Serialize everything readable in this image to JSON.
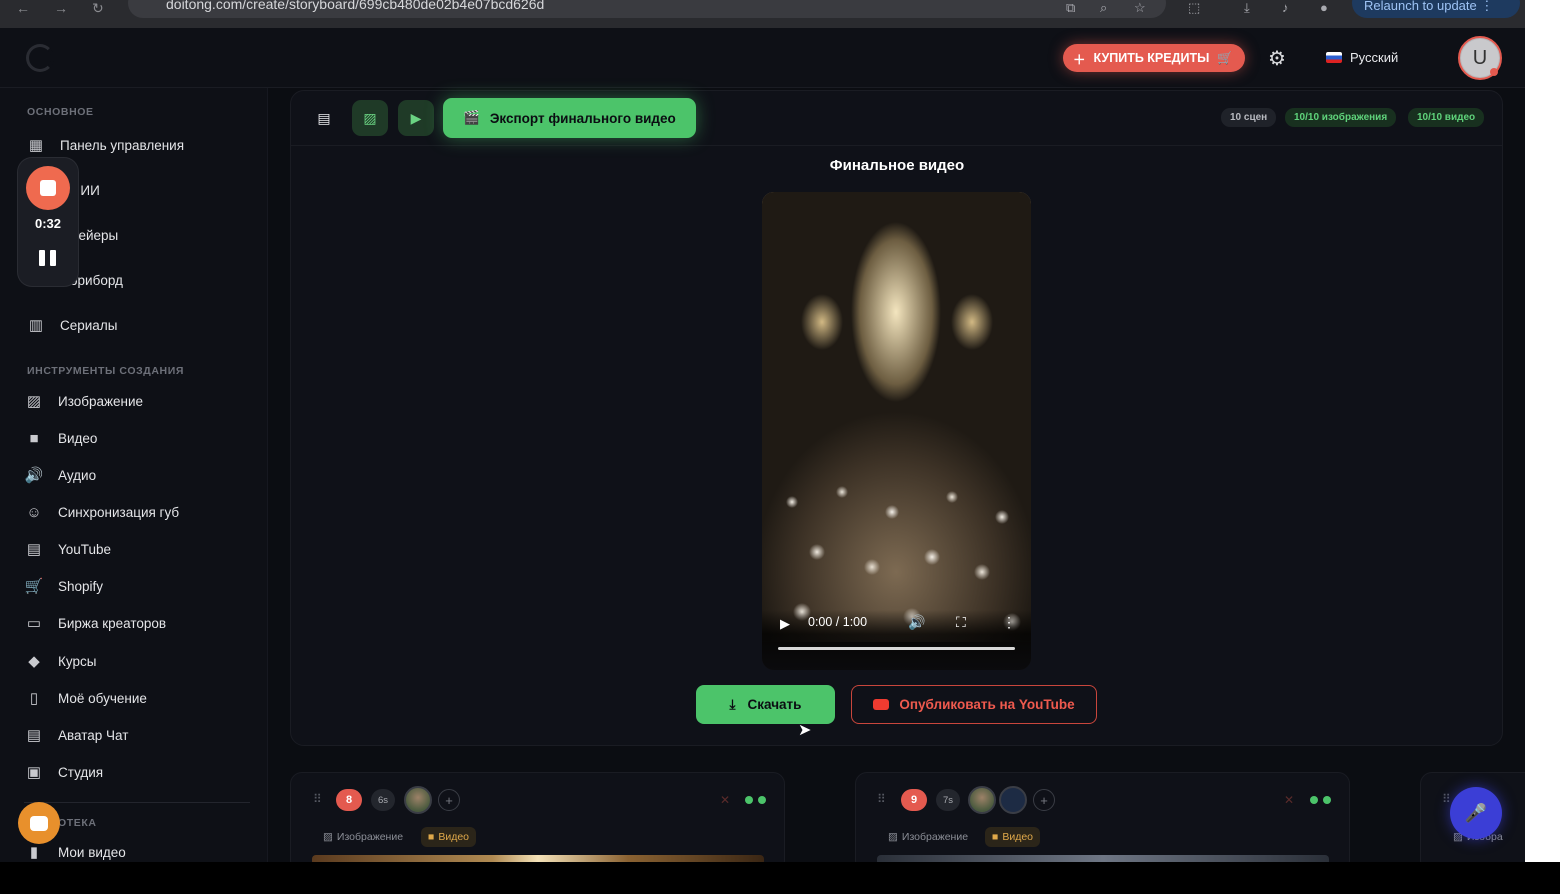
{
  "browser": {
    "url": "doitong.com/create/storyboard/699cb480de02b4e07bcd626d",
    "relaunch": "Relaunch to update"
  },
  "header": {
    "buy_credits": "КУПИТЬ КРЕДИТЫ",
    "language": "Русский",
    "avatar_letter": "U"
  },
  "recorder": {
    "time": "0:32"
  },
  "sidebar": {
    "section_main": "ОСНОВНОЕ",
    "main_items": [
      {
        "label": "Панель управления",
        "icon": "dashboard-icon"
      },
      {
        "label": "т с ИИ",
        "icon": "chat-icon"
      },
      {
        "label": "нвейеры",
        "icon": "pipeline-icon"
      },
      {
        "label": "ториборд",
        "icon": "storyboard-icon"
      },
      {
        "label": "Сериалы",
        "icon": "series-icon"
      }
    ],
    "section_tools": "ИНСТРУМЕНТЫ СОЗДАНИЯ",
    "tool_items": [
      {
        "label": "Изображение",
        "icon": "image-icon"
      },
      {
        "label": "Видео",
        "icon": "video-icon"
      },
      {
        "label": "Аудио",
        "icon": "audio-icon"
      },
      {
        "label": "Синхронизация губ",
        "icon": "lipsync-icon"
      },
      {
        "label": "YouTube",
        "icon": "youtube-icon"
      },
      {
        "label": "Shopify",
        "icon": "cart-icon"
      },
      {
        "label": "Биржа креаторов",
        "icon": "briefcase-icon"
      },
      {
        "label": "Курсы",
        "icon": "graduation-icon"
      },
      {
        "label": "Моё обучение",
        "icon": "book-icon"
      },
      {
        "label": "Аватар Чат",
        "icon": "message-icon"
      },
      {
        "label": "Студия",
        "icon": "studio-icon"
      }
    ],
    "section_library": "ОТЕКА",
    "library_items": [
      {
        "label": "Мои видео",
        "icon": "file-icon"
      }
    ]
  },
  "toolbar": {
    "export_label": "Экспорт финального видео",
    "badge_scenes": "10 сцен",
    "badge_images": "10/10 изображения",
    "badge_videos": "10/10 видео"
  },
  "player": {
    "title": "Финальное видео",
    "time": "0:00 / 1:00",
    "progress": 0
  },
  "actions": {
    "download": "Скачать",
    "publish_youtube": "Опубликовать на YouTube"
  },
  "scenes": [
    {
      "number": "8",
      "duration": "6s",
      "tab_image": "Изображение",
      "tab_video": "Видео"
    },
    {
      "number": "9",
      "duration": "7s",
      "tab_image": "Изображение",
      "tab_video": "Видео"
    },
    {
      "tab_image": "Изобра"
    }
  ],
  "colors": {
    "accent_green": "#4cc46a",
    "accent_red": "#e45a4f",
    "background": "#0b0d12"
  }
}
